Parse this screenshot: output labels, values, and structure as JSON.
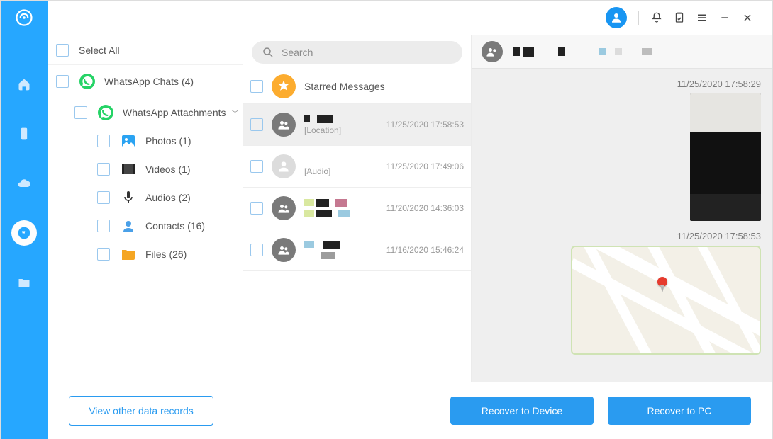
{
  "sidebar": {
    "select_all": "Select All",
    "chats": "WhatsApp Chats (4)",
    "attachments": "WhatsApp Attachments",
    "items": {
      "photos": "Photos (1)",
      "videos": "Videos (1)",
      "audios": "Audios (2)",
      "contacts": "Contacts (16)",
      "files": "Files (26)"
    }
  },
  "search": {
    "placeholder": "Search"
  },
  "center": {
    "starred": "Starred Messages",
    "entries": [
      {
        "sub": "[Location]",
        "time": "11/25/2020 17:58:53"
      },
      {
        "sub": "[Audio]",
        "time": "11/25/2020 17:49:06"
      },
      {
        "sub": "",
        "time": "11/20/2020 14:36:03"
      },
      {
        "sub": "",
        "time": "11/16/2020 15:46:24"
      }
    ]
  },
  "detail": {
    "msgs": [
      {
        "time": "11/25/2020 17:58:29",
        "type": "photo"
      },
      {
        "time": "11/25/2020 17:58:53",
        "type": "location"
      }
    ]
  },
  "footer": {
    "other": "View other data records",
    "to_device": "Recover to Device",
    "to_pc": "Recover to PC"
  }
}
